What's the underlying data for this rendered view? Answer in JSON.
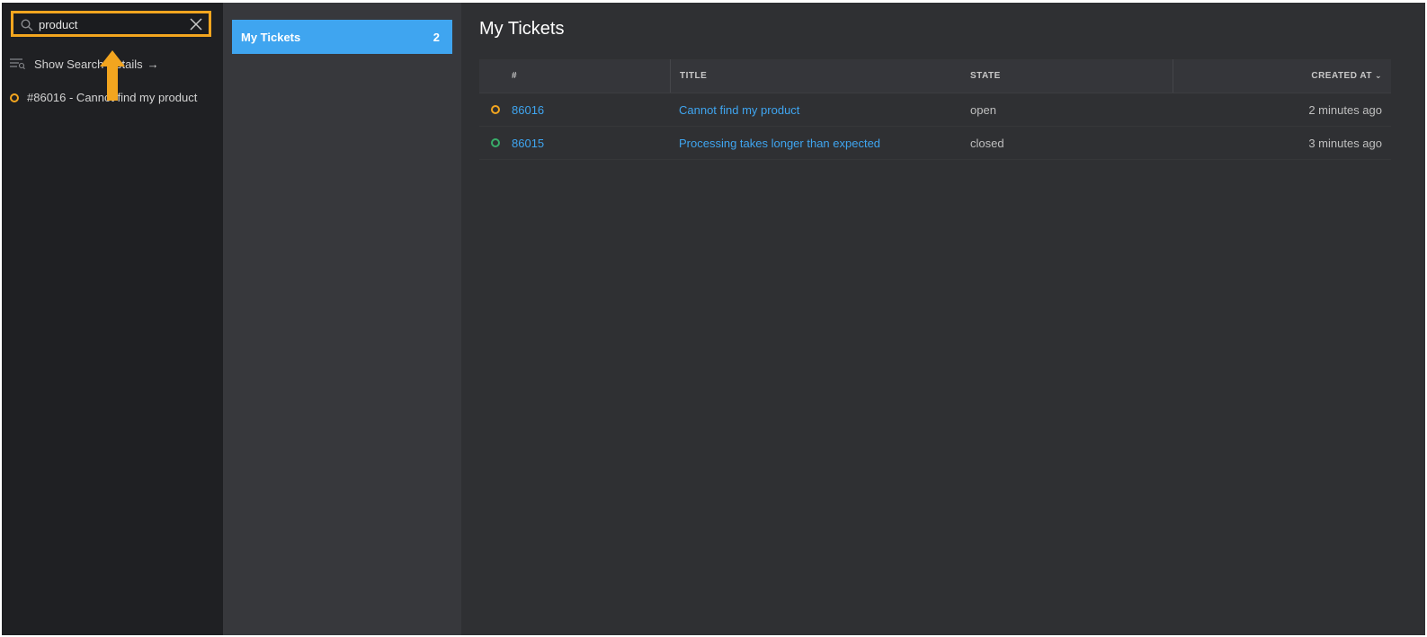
{
  "search": {
    "value": "product",
    "show_details_label": "Show Search Details",
    "results": [
      {
        "label": "#86016 - Cannot find my product",
        "status_color": "#f2a51f"
      }
    ]
  },
  "overview": {
    "items": [
      {
        "label": "My Tickets",
        "count": "2"
      }
    ]
  },
  "main": {
    "title": "My Tickets",
    "columns": {
      "number": "#",
      "title": "TITLE",
      "state": "STATE",
      "created": "CREATED AT"
    },
    "rows": [
      {
        "number": "86016",
        "title": "Cannot find my product",
        "state": "open",
        "created": "2 minutes ago",
        "status_color": "#f2a51f"
      },
      {
        "number": "86015",
        "title": "Processing takes longer than expected",
        "state": "closed",
        "created": "3 minutes ago",
        "status_color": "#38ad69"
      }
    ]
  },
  "colors": {
    "accent": "#3fa5f0",
    "highlight": "#f2a51f",
    "open": "#f2a51f",
    "closed": "#38ad69"
  },
  "icons": [
    "search-icon",
    "clear-icon",
    "search-details-icon",
    "arrow-right-icon",
    "status-open-icon",
    "status-closed-icon",
    "sort-desc-icon",
    "annotation-arrow-up"
  ]
}
